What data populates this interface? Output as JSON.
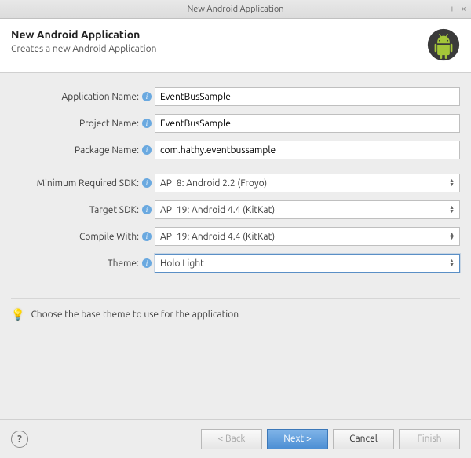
{
  "window": {
    "title": "New Android Application"
  },
  "header": {
    "title": "New Android Application",
    "subtitle": "Creates a new Android Application"
  },
  "form": {
    "app_name": {
      "label": "Application Name:",
      "value": "EventBusSample"
    },
    "proj_name": {
      "label": "Project Name:",
      "value": "EventBusSample"
    },
    "pkg_name": {
      "label": "Package Name:",
      "value": "com.hathy.eventbussample"
    },
    "min_sdk": {
      "label": "Minimum Required SDK:",
      "value": "API 8: Android 2.2 (Froyo)"
    },
    "target_sdk": {
      "label": "Target SDK:",
      "value": "API 19: Android 4.4 (KitKat)"
    },
    "compile_with": {
      "label": "Compile With:",
      "value": "API 19: Android 4.4 (KitKat)"
    },
    "theme": {
      "label": "Theme:",
      "value": "Holo Light"
    }
  },
  "hint": "Choose the base theme to use for the application",
  "buttons": {
    "back": "< Back",
    "next": "Next >",
    "cancel": "Cancel",
    "finish": "Finish"
  }
}
